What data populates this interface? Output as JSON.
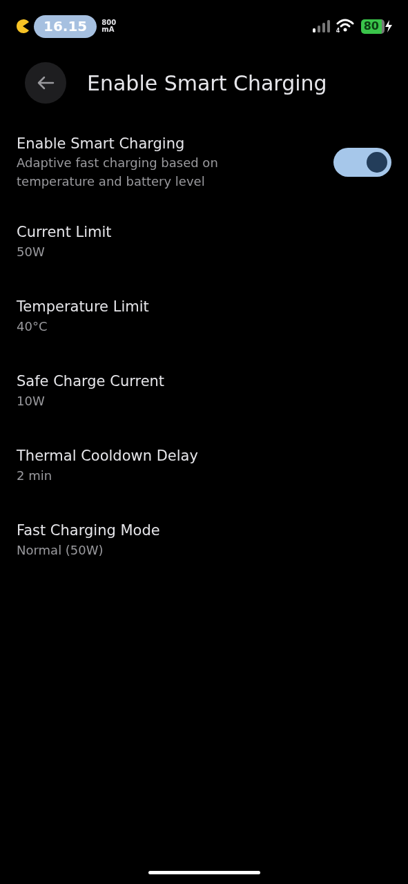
{
  "status_bar": {
    "time": "16.15",
    "current_value": "800",
    "current_unit": "mA",
    "wifi_badge": "4",
    "battery": "80",
    "charging": true
  },
  "header": {
    "title": "Enable Smart Charging"
  },
  "settings": [
    {
      "kind": "toggle",
      "title": "Enable Smart Charging",
      "summary": "Adaptive fast charging based on temperature and battery level",
      "on": true
    },
    {
      "kind": "value",
      "title": "Current Limit",
      "summary": "50W"
    },
    {
      "kind": "value",
      "title": "Temperature Limit",
      "summary": "40°C"
    },
    {
      "kind": "value",
      "title": "Safe Charge Current",
      "summary": "10W"
    },
    {
      "kind": "value",
      "title": "Thermal Cooldown Delay",
      "summary": "2 min"
    },
    {
      "kind": "value",
      "title": "Fast Charging Mode",
      "summary": "Normal (50W)"
    }
  ]
}
